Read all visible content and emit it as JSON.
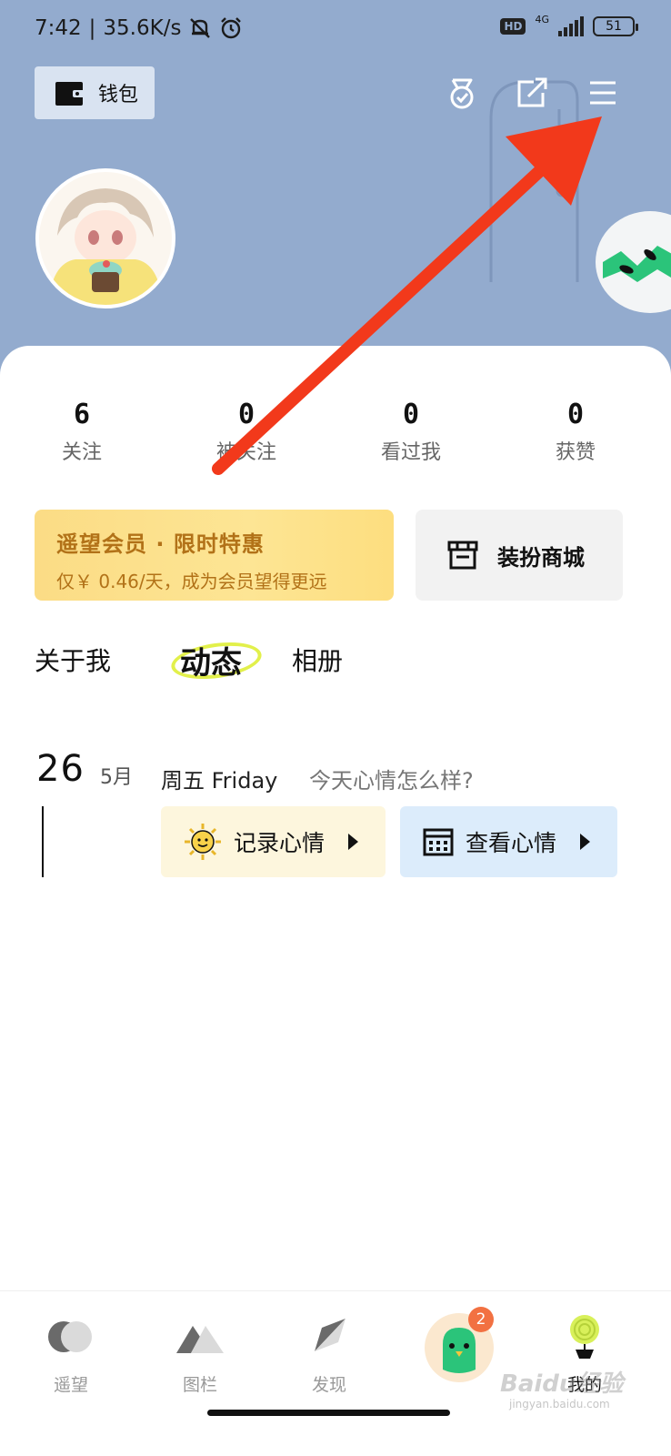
{
  "status_bar": {
    "time": "7:42",
    "separator": "|",
    "speed": "35.6K/s",
    "network": "4G",
    "hd": "HD",
    "battery": "51"
  },
  "header": {
    "wallet_label": "钱包",
    "menu_icon": "hamburger-menu-icon",
    "badge_icon": "medal-icon",
    "share_icon": "share-icon"
  },
  "stats": [
    {
      "value": "6",
      "label": "关注"
    },
    {
      "value": "0",
      "label": "被关注"
    },
    {
      "value": "0",
      "label": "看过我"
    },
    {
      "value": "0",
      "label": "获赞"
    }
  ],
  "vip": {
    "title": "遥望会员 · 限时特惠",
    "subtitle": "仅￥ 0.46/天，成为会员望得更远"
  },
  "shop": {
    "label": "装扮商城"
  },
  "tabs": [
    {
      "label": "关于我",
      "active": false
    },
    {
      "label": "动态",
      "active": true
    },
    {
      "label": "相册",
      "active": false
    }
  ],
  "feed": {
    "day": "26",
    "month": "5月",
    "weekday": "周五 Friday",
    "question": "今天心情怎么样?",
    "record_label": "记录心情",
    "view_label": "查看心情"
  },
  "bottom_nav": [
    {
      "label": "遥望",
      "icon": "moon-circles-icon"
    },
    {
      "label": "图栏",
      "icon": "mountains-icon"
    },
    {
      "label": "发现",
      "icon": "paper-plane-icon"
    },
    {
      "label": "",
      "icon": "bird-avatar-icon"
    },
    {
      "label": "我的",
      "icon": "lollipop-icon"
    }
  ],
  "nav_badge": "2",
  "watermark": {
    "text": "Baidu经验",
    "sub": "jingyan.baidu.com"
  },
  "colors": {
    "header_bg": "#93abce",
    "vip_text": "#b27218",
    "arrow": "#f2391b",
    "accent_yellow": "#e2f04b",
    "badge": "#f27142"
  }
}
